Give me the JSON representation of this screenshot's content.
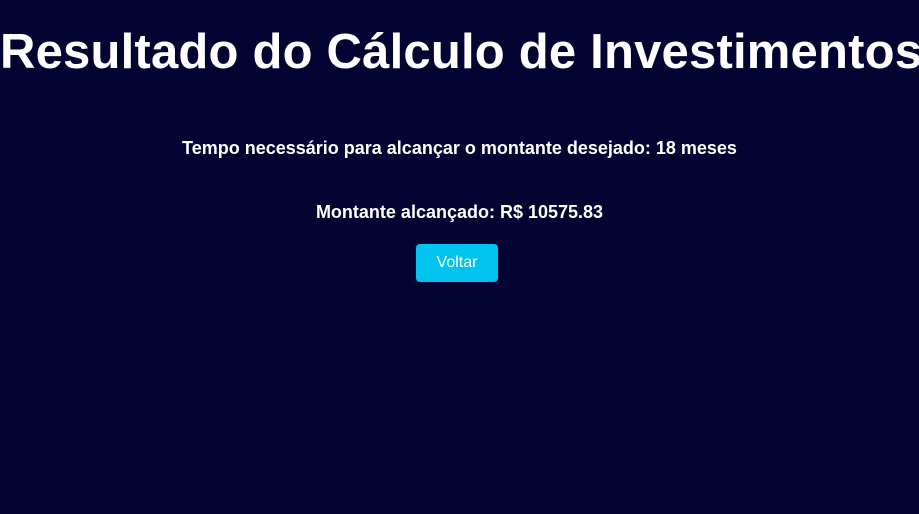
{
  "page": {
    "title": "Resultado do Cálculo de Investimentos"
  },
  "result": {
    "time_text": "Tempo necessário para alcançar o montante desejado: 18 meses",
    "amount_text": "Montante alcançado: R$ 10575.83"
  },
  "actions": {
    "back_label": "Voltar"
  },
  "colors": {
    "background": "#030432",
    "text": "#ffffff",
    "button": "#00c4ed"
  }
}
